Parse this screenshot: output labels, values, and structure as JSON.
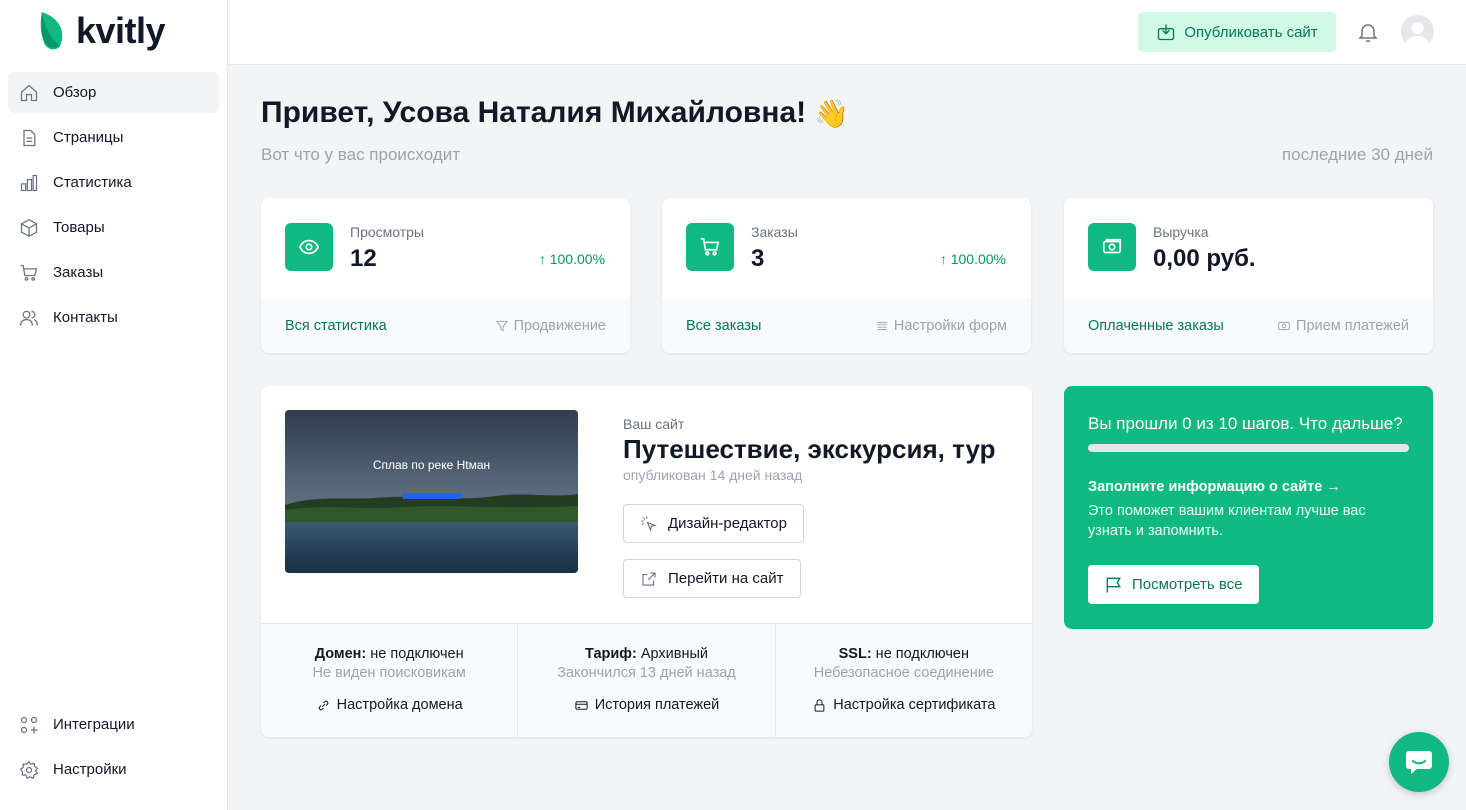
{
  "brand": {
    "name": "kvitly",
    "accent": "#10b981"
  },
  "sidebar": {
    "items": [
      {
        "label": "Обзор",
        "icon": "home-icon",
        "active": true
      },
      {
        "label": "Страницы",
        "icon": "document-icon"
      },
      {
        "label": "Статистика",
        "icon": "bar-chart-icon"
      },
      {
        "label": "Товары",
        "icon": "cube-icon"
      },
      {
        "label": "Заказы",
        "icon": "cart-icon"
      },
      {
        "label": "Контакты",
        "icon": "users-icon"
      }
    ],
    "bottom": [
      {
        "label": "Интеграции",
        "icon": "integrations-icon"
      },
      {
        "label": "Настройки",
        "icon": "gear-icon"
      }
    ]
  },
  "topbar": {
    "publish_label": "Опубликовать сайт"
  },
  "header": {
    "greeting": "Привет, Усова Наталия Михайловна!",
    "emoji": "👋",
    "subtitle": "Вот что у вас происходит",
    "period": "последние 30 дней"
  },
  "stats": [
    {
      "label": "Просмотры",
      "value": "12",
      "change": "↑ 100.00%",
      "icon": "eye-icon",
      "primary_link": "Вся статистика",
      "secondary_link": "Продвижение",
      "secondary_icon": "funnel-icon"
    },
    {
      "label": "Заказы",
      "value": "3",
      "change": "↑ 100.00%",
      "icon": "cart-icon",
      "primary_link": "Все заказы",
      "secondary_link": "Настройки форм",
      "secondary_icon": "list-icon"
    },
    {
      "label": "Выручка",
      "value": "0,00 руб.",
      "change": "",
      "icon": "cash-icon",
      "primary_link": "Оплаченные заказы",
      "secondary_link": "Прием платежей",
      "secondary_icon": "cash-icon"
    }
  ],
  "site": {
    "kicker": "Ваш сайт",
    "name": "Путешествие, экскурсия, тур",
    "published": "опубликован 14 дней назад",
    "thumb_title": "Сплав по реке Htман",
    "design_label": "Дизайн-редактор",
    "visit_label": "Перейти на сайт",
    "domain": {
      "key": "Домен:",
      "value": " не подключен",
      "note": "Не виден поисковикам",
      "link": "Настройка домена"
    },
    "plan": {
      "key": "Тариф:",
      "value": " Архивный",
      "note": "Закончился 13 дней назад",
      "link": "История платежей"
    },
    "ssl": {
      "key": "SSL:",
      "value": " не подключен",
      "note": "Небезопасное соединение",
      "link": "Настройка сертификата"
    }
  },
  "steps": {
    "title": "Вы прошли 0 из 10 шагов. Что дальше?",
    "done": 0,
    "total": 10,
    "link": "Заполните информацию о сайте →",
    "desc": "Это поможет вашим клиентам лучше вас узнать и запомнить.",
    "button": "Посмотреть все"
  }
}
